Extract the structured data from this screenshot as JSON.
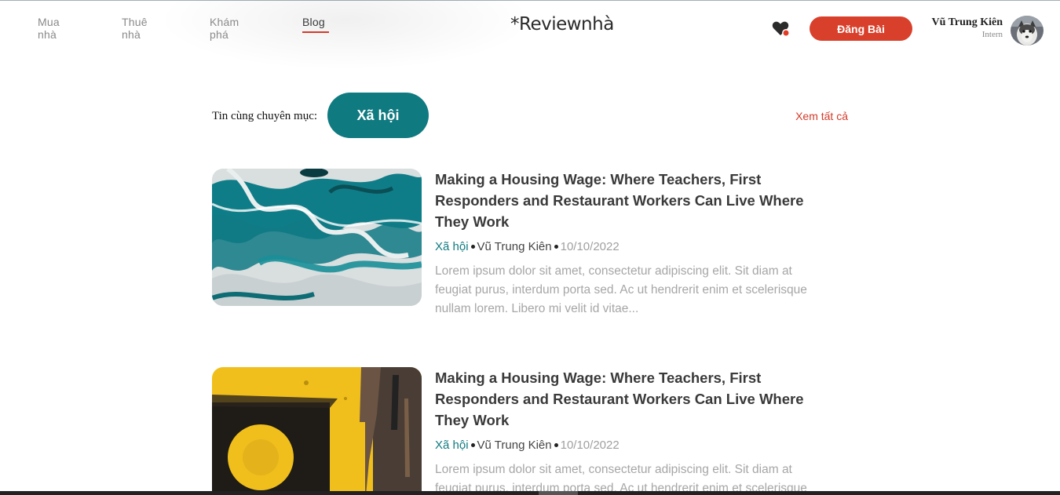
{
  "nav": {
    "items": [
      {
        "label": "Mua nhà"
      },
      {
        "label": "Thuê nhà"
      },
      {
        "label": "Khám phá"
      },
      {
        "label": "Blog"
      }
    ]
  },
  "brand": {
    "logo": "*Reviewnhà"
  },
  "header": {
    "favorites_icon": "heart-icon",
    "post_button": "Đăng Bài",
    "user": {
      "name": "Vũ Trung Kiên",
      "role": "Intern"
    }
  },
  "section": {
    "label": "Tin cùng chuyên mục:",
    "category": "Xã hội",
    "see_all": "Xem tất cả"
  },
  "articles": [
    {
      "title": "Making a Housing Wage: Where Teachers, First Responders and Restaurant Workers Can Live Where They Work",
      "category": "Xã hội",
      "author": "Vũ Trung Kiên",
      "date": "10/10/2022",
      "excerpt": "Lorem ipsum dolor sit amet, consectetur adipiscing elit. Sit diam at feugiat purus, interdum porta sed. Ac ut hendrerit enim et scelerisque nullam lorem. Libero mi velit id vitae..."
    },
    {
      "title": "Making a Housing Wage: Where Teachers, First Responders and Restaurant Workers Can Live Where They Work",
      "category": "Xã hội",
      "author": "Vũ Trung Kiên",
      "date": "10/10/2022",
      "excerpt": "Lorem ipsum dolor sit amet, consectetur adipiscing elit. Sit diam at feugiat purus, interdum porta sed. Ac ut hendrerit enim et scelerisque nullam lorem. Libero mi velit id vitae..."
    }
  ],
  "colors": {
    "accent_red": "#d9402b",
    "teal": "#0f7a80",
    "muted_text": "#a6a6a6"
  }
}
